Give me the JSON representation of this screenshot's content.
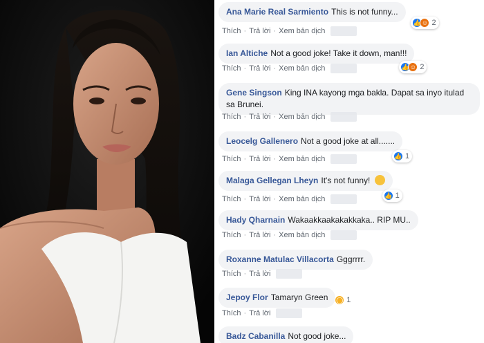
{
  "actions": {
    "like": "Thích",
    "reply": "Trả lời",
    "translate": "Xem bản dịch",
    "sep": "·"
  },
  "comments": [
    {
      "author": "Ana Marie Real Sarmiento",
      "text": "This is not funny...",
      "reactions": [
        "like-icon",
        "angry-icon"
      ],
      "count": "2",
      "translate": true
    },
    {
      "author": "Ian Altiche",
      "text": "Not a good joke! Take it down, man!!!",
      "reactions": [
        "like-icon",
        "angry-icon"
      ],
      "count": "2",
      "translate": true
    },
    {
      "author": "Gene Singson",
      "text": "King INA kayong mga bakla. Dapat sa inyo itulad sa Brunei.",
      "reactions": [],
      "count": "",
      "translate": true
    },
    {
      "author": "Leocelg Gallenero",
      "text": "Not a good joke at all.......",
      "reactions": [
        "like-icon"
      ],
      "count": "1",
      "translate": true
    },
    {
      "author": "Malaga Gellegan Lheyn",
      "text": "It's not funny!",
      "reactions": [
        "like-icon"
      ],
      "count": "1",
      "translate": true,
      "emoji": "unamused-face-emoji"
    },
    {
      "author": "Hady Qharnain",
      "text": "Wakaakkaakakakkaka.. RIP MU..",
      "reactions": [],
      "count": "",
      "translate": true
    },
    {
      "author": "Roxanne Matulac Villacorta",
      "text": "Gggrrrr.",
      "reactions": [],
      "count": "",
      "translate": false
    },
    {
      "author": "Jepoy Flor",
      "text": "Tamaryn Green",
      "reactions": [
        "wow-icon"
      ],
      "count": "1",
      "translate": false
    },
    {
      "author": "Badz Cabanilla",
      "text": "Not good joke...",
      "reactions": [],
      "count": "",
      "translate": false
    }
  ],
  "colors": {
    "author": "#385898",
    "bubble": "#f2f3f5",
    "like": "#1877f2",
    "angry": "#e9710f",
    "wow": "#f7b125"
  }
}
